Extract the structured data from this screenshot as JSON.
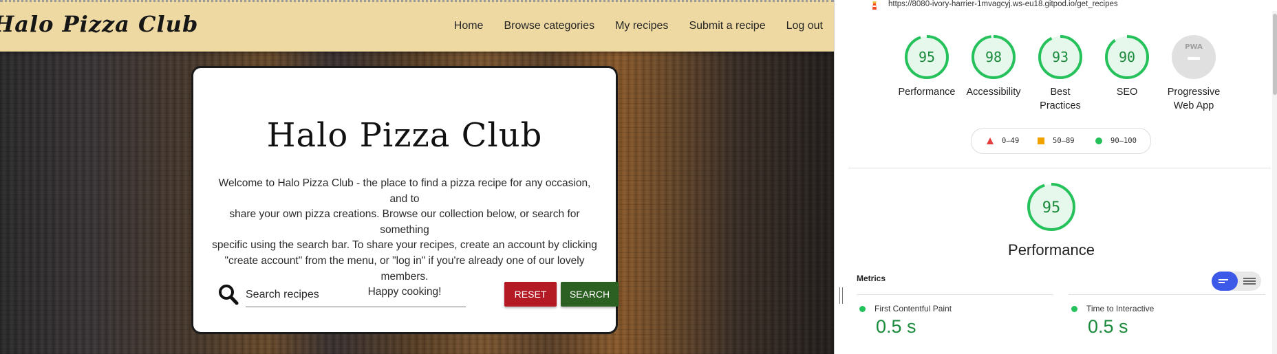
{
  "site": {
    "brand": "Halo Pizza Club",
    "nav": [
      "Home",
      "Browse categories",
      "My recipes",
      "Submit a recipe",
      "Log out"
    ],
    "card": {
      "title": "Halo Pizza Club",
      "lines": [
        "Welcome to Halo Pizza Club - the place to find a pizza recipe for any occasion, and to",
        "share your own pizza creations. Browse our collection below, or search for something",
        "specific using the search bar. To share your recipes, create an account by clicking",
        "\"create account\" from the menu, or \"log in\" if you're already one of our lovely members.",
        "Happy cooking!"
      ],
      "search_placeholder": "Search recipes",
      "reset_label": "Reset",
      "search_label": "Search"
    },
    "colors": {
      "nav_bg": "#eed9a3",
      "reset_btn": "#b31a24",
      "search_btn": "#2c5f22"
    }
  },
  "devtools": {
    "url": "https://8080-ivory-harrier-1mvagcyj.ws-eu18.gitpod.io/get_recipes",
    "gauges": [
      {
        "score": "95",
        "value": 95,
        "label_lines": [
          "Performance"
        ],
        "color": "#25c15a"
      },
      {
        "score": "98",
        "value": 98,
        "label_lines": [
          "Accessibility"
        ],
        "color": "#25c15a"
      },
      {
        "score": "93",
        "value": 93,
        "label_lines": [
          "Best",
          "Practices"
        ],
        "color": "#25c15a"
      },
      {
        "score": "90",
        "value": 90,
        "label_lines": [
          "SEO"
        ],
        "color": "#25c15a"
      },
      {
        "score": "PWA",
        "value": null,
        "label_lines": [
          "Progressive",
          "Web App"
        ],
        "color": "#cccccc"
      }
    ],
    "legend": {
      "fail": "0–49",
      "average": "50–89",
      "pass": "90–100"
    },
    "performance": {
      "score": "95",
      "value": 95,
      "title": "Performance"
    },
    "metrics_heading": "Metrics",
    "metrics": [
      {
        "name": "First Contentful Paint",
        "value": "0.5 s"
      },
      {
        "name": "Time to Interactive",
        "value": "0.5 s"
      }
    ]
  }
}
